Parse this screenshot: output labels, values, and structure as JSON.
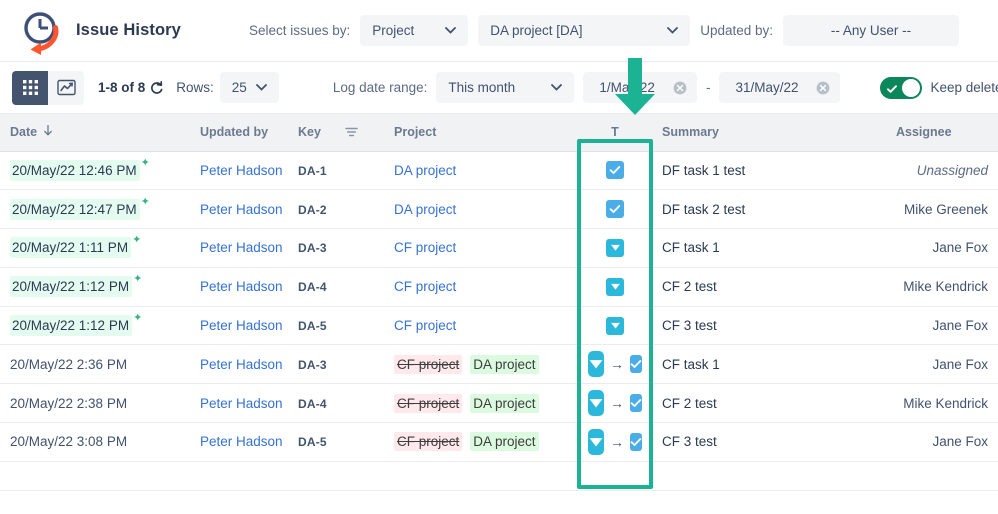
{
  "app": {
    "title": "Issue History",
    "logo_icon": "clock-with-arrow-icon"
  },
  "header": {
    "select_issues_label": "Select issues by:",
    "select_issues_value": "Project",
    "project_value": "DA project [DA]",
    "updated_by_label": "Updated by:",
    "updated_by_value": "-- Any User --"
  },
  "toolbar": {
    "grid_view_icon": "grid-view-icon",
    "chart_view_icon": "chart-view-icon",
    "count_text": "1-8 of 8",
    "refresh_icon": "refresh-icon",
    "rows_label": "Rows:",
    "rows_value": "25",
    "log_date_label": "Log date range:",
    "range_preset": "This month",
    "date_from": "1/May/22",
    "date_to": "31/May/22",
    "date_separator": "-",
    "clear_icon": "clear-circle-icon",
    "keep_deleted_label": "Keep deleted",
    "keep_deleted_on": true
  },
  "table": {
    "columns": [
      {
        "key": "date",
        "label": "Date",
        "sort_icon": "arrow-down-icon"
      },
      {
        "key": "updated_by",
        "label": "Updated by"
      },
      {
        "key": "key",
        "label": "Key",
        "filter_icon": "filter-icon"
      },
      {
        "key": "project",
        "label": "Project"
      },
      {
        "key": "type",
        "label": "T"
      },
      {
        "key": "summary",
        "label": "Summary"
      },
      {
        "key": "assignee",
        "label": "Assignee"
      }
    ],
    "rows": [
      {
        "date": "20/May/22 12:46 PM",
        "date_new": true,
        "updated_by": "Peter Hadson",
        "key": "DA-1",
        "project": "DA project",
        "project_changed": false,
        "type_icon": "task-checkbox-icon",
        "type_changed": false,
        "summary": "DF task 1 test",
        "assignee": "Unassigned",
        "assignee_unassigned": true
      },
      {
        "date": "20/May/22 12:47 PM",
        "date_new": true,
        "updated_by": "Peter Hadson",
        "key": "DA-2",
        "project": "DA project",
        "project_changed": false,
        "type_icon": "task-checkbox-icon",
        "type_changed": false,
        "summary": "DF task 2 test",
        "assignee": "Mike Greenek",
        "assignee_unassigned": false
      },
      {
        "date": "20/May/22 1:11 PM",
        "date_new": true,
        "updated_by": "Peter Hadson",
        "key": "DA-3",
        "project": "CF project",
        "project_changed": false,
        "type_icon": "subtask-arrow-icon",
        "type_changed": false,
        "summary": "CF task 1",
        "assignee": "Jane Fox",
        "assignee_unassigned": false
      },
      {
        "date": "20/May/22 1:12 PM",
        "date_new": true,
        "updated_by": "Peter Hadson",
        "key": "DA-4",
        "project": "CF project",
        "project_changed": false,
        "type_icon": "subtask-arrow-icon",
        "type_changed": false,
        "summary": "CF 2 test",
        "assignee": "Mike Kendrick",
        "assignee_unassigned": false
      },
      {
        "date": "20/May/22 1:12 PM",
        "date_new": true,
        "updated_by": "Peter Hadson",
        "key": "DA-5",
        "project": "CF project",
        "project_changed": false,
        "type_icon": "subtask-arrow-icon",
        "type_changed": false,
        "summary": "CF 3 test",
        "assignee": "Jane Fox",
        "assignee_unassigned": false
      },
      {
        "date": "20/May/22 2:36 PM",
        "date_new": false,
        "updated_by": "Peter Hadson",
        "key": "DA-3",
        "project_changed": true,
        "project_old": "CF project",
        "project_new": "DA project",
        "type_changed": true,
        "type_icon_old": "subtask-arrow-icon",
        "type_icon_new": "task-checkbox-icon",
        "summary": "CF task 1",
        "assignee": "Jane Fox",
        "assignee_unassigned": false
      },
      {
        "date": "20/May/22 2:38 PM",
        "date_new": false,
        "updated_by": "Peter Hadson",
        "key": "DA-4",
        "project_changed": true,
        "project_old": "CF project",
        "project_new": "DA project",
        "type_changed": true,
        "type_icon_old": "subtask-arrow-icon",
        "type_icon_new": "task-checkbox-icon",
        "summary": "CF 2 test",
        "assignee": "Mike Kendrick",
        "assignee_unassigned": false
      },
      {
        "date": "20/May/22 3:08 PM",
        "date_new": false,
        "updated_by": "Peter Hadson",
        "key": "DA-5",
        "project_changed": true,
        "project_old": "CF project",
        "project_new": "DA project",
        "type_changed": true,
        "type_icon_old": "subtask-arrow-icon",
        "type_icon_new": "task-checkbox-icon",
        "summary": "CF 3 test",
        "assignee": "Jane Fox",
        "assignee_unassigned": false
      }
    ]
  },
  "annotations": {
    "highlight_color": "#1bb394",
    "arrow_icon": "down-arrow-annotation",
    "box_target_column": "T"
  },
  "colors": {
    "accent_green": "#1bb394",
    "link_blue": "#3572d4",
    "task_icon_blue": "#4bade8",
    "subtask_icon_cyan": "#2bb8da",
    "added_bg": "#dcfadf",
    "removed_bg": "#ffe9ec",
    "new_row_bg": "#e3fcef",
    "toggle_on": "#0b875b",
    "logo_orange": "#ff5630"
  }
}
